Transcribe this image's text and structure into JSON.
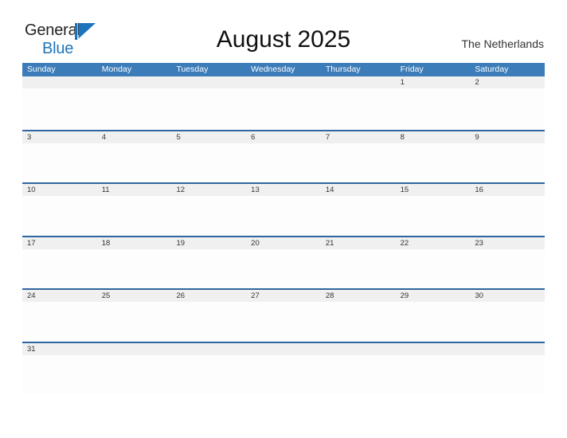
{
  "logo": {
    "text_primary": "General",
    "text_secondary": "Blue",
    "triangle_icon": "triangle-icon",
    "primary_color": "#231f20",
    "secondary_color": "#1d74bb"
  },
  "header": {
    "title": "August 2025",
    "locale": "The Netherlands"
  },
  "theme": {
    "header_background": "#3b7cb9",
    "header_text": "#ffffff",
    "row_border": "#2e669f",
    "date_band": "#f0f0f0",
    "cell_background": "#fdfdfd",
    "date_text": "#333333"
  },
  "calendar": {
    "month": "August",
    "year": "2025",
    "weekdays": [
      "Sunday",
      "Monday",
      "Tuesday",
      "Wednesday",
      "Thursday",
      "Friday",
      "Saturday"
    ],
    "weeks": [
      [
        "",
        "",
        "",
        "",
        "",
        "1",
        "2"
      ],
      [
        "3",
        "4",
        "5",
        "6",
        "7",
        "8",
        "9"
      ],
      [
        "10",
        "11",
        "12",
        "13",
        "14",
        "15",
        "16"
      ],
      [
        "17",
        "18",
        "19",
        "20",
        "21",
        "22",
        "23"
      ],
      [
        "24",
        "25",
        "26",
        "27",
        "28",
        "29",
        "30"
      ],
      [
        "31",
        "",
        "",
        "",
        "",
        "",
        ""
      ]
    ]
  }
}
